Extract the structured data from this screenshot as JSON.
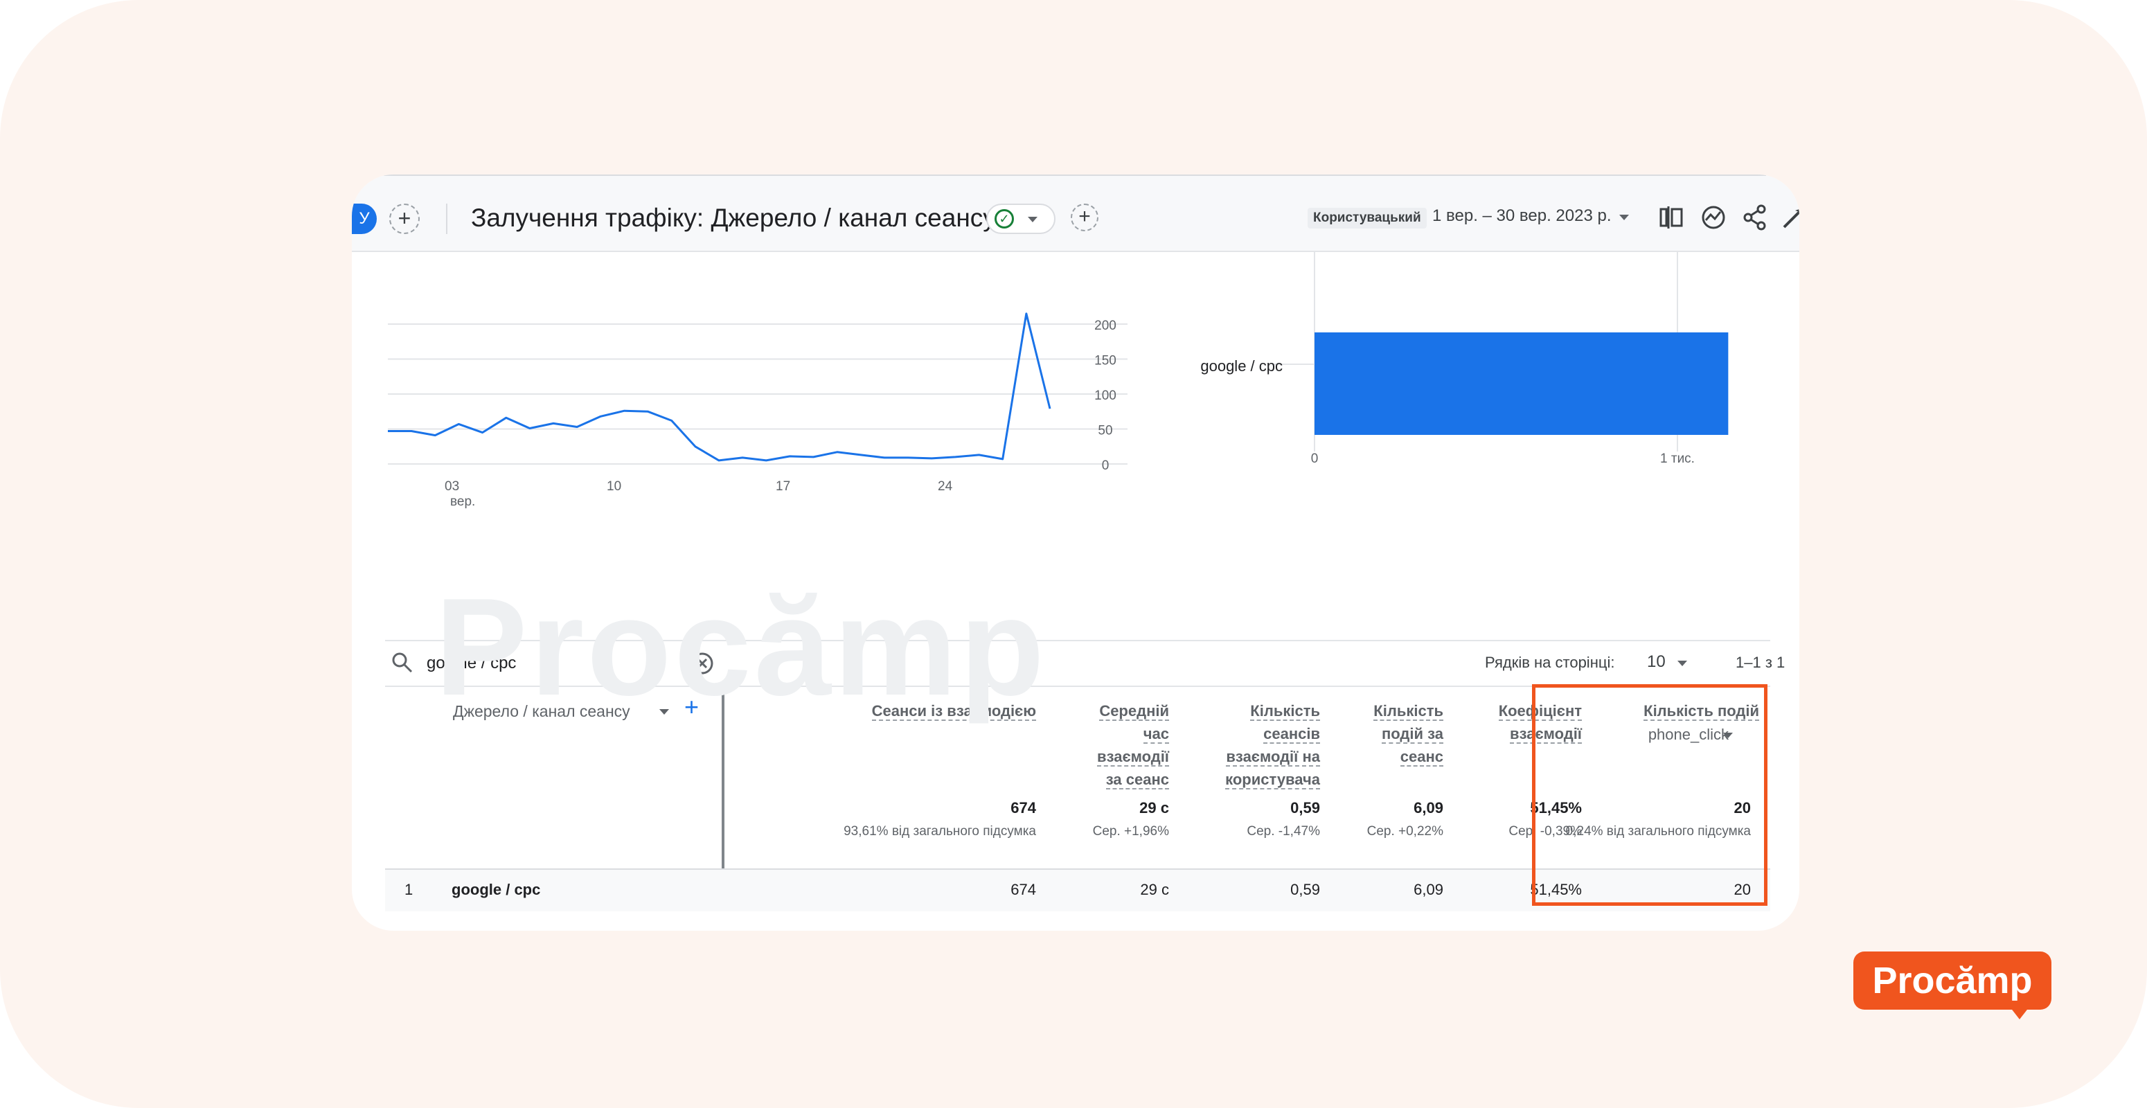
{
  "header": {
    "avatar_letter": "У",
    "title": "Залучення трафіку: Джерело / канал сеансу",
    "chip": "Користувацький",
    "date_range": "1 вер. – 30 вер. 2023 р.",
    "icons": [
      "compare-icon",
      "insights-icon",
      "share-icon",
      "customize-icon"
    ]
  },
  "line_chart": {
    "x_tick_labels": [
      "03",
      "вер.",
      "10",
      "17",
      "24"
    ],
    "y_tick_labels": [
      "200",
      "150",
      "100",
      "50",
      "0"
    ]
  },
  "bar_chart": {
    "category": "google / cpc",
    "x_tick_labels": [
      "0",
      "1 тис."
    ]
  },
  "chart_data": [
    {
      "type": "line",
      "x_ticks": [
        "03 вер.",
        "10",
        "17",
        "24"
      ],
      "x": [
        1,
        2,
        3,
        4,
        5,
        6,
        7,
        8,
        9,
        10,
        11,
        12,
        13,
        14,
        15,
        16,
        17,
        18,
        19,
        20,
        21,
        22,
        23,
        24,
        25,
        26,
        27,
        28,
        29,
        30
      ],
      "y": [
        47,
        47,
        41,
        57,
        45,
        66,
        51,
        58,
        53,
        68,
        76,
        75,
        62,
        25,
        5,
        9,
        5,
        11,
        10,
        17,
        13,
        9,
        9,
        8,
        10,
        13,
        7,
        215,
        79
      ],
      "ylim": [
        0,
        220
      ],
      "y_ticks": [
        0,
        50,
        100,
        150,
        200
      ],
      "grid": true
    },
    {
      "type": "bar",
      "orientation": "horizontal",
      "categories": [
        "google / cpc"
      ],
      "values": [
        1140
      ],
      "xlim": [
        0,
        1250
      ],
      "x_ticks": [
        "0",
        "1 тис."
      ]
    }
  ],
  "search": {
    "value": "google / cpc"
  },
  "pagination": {
    "rows_label": "Рядків на сторінці:",
    "rows_value": "10",
    "range": "1–1 з 1"
  },
  "table": {
    "dimension_header": "Джерело / канал сеансу",
    "columns": [
      {
        "header": [
          "Сеанси із взаємодією"
        ],
        "total": "674",
        "sub": "93,61% від загального підсумка",
        "row": "674"
      },
      {
        "header": [
          "Середній",
          "час",
          "взаємодії",
          "за сеанс"
        ],
        "total": "29 с",
        "sub": "Сер. +1,96%",
        "row": "29 с"
      },
      {
        "header": [
          "Кількість",
          "сеансів",
          "взаємодії на",
          "користувача"
        ],
        "total": "0,59",
        "sub": "Сер. -1,47%",
        "row": "0,59"
      },
      {
        "header": [
          "Кількість",
          "подій за",
          "сеанс"
        ],
        "total": "6,09",
        "sub": "Сер. +0,22%",
        "row": "6,09"
      },
      {
        "header": [
          "Коефіцієнт",
          "взаємодії"
        ],
        "total": "51,45%",
        "sub": "Сер. -0,39%",
        "row": "51,45%"
      },
      {
        "header": [
          "Кількість подій"
        ],
        "event": "phone_click",
        "total": "20",
        "sub": "0,24% від загального підсумка",
        "row": "20"
      }
    ],
    "rows": [
      {
        "index": "1",
        "dimension": "google / cpc"
      }
    ]
  },
  "watermark": "Procămp",
  "brand": {
    "name": "Procămp",
    "color": "#f0551e"
  },
  "colors": {
    "accent": "#1a73e8",
    "highlight": "#f0551e"
  }
}
